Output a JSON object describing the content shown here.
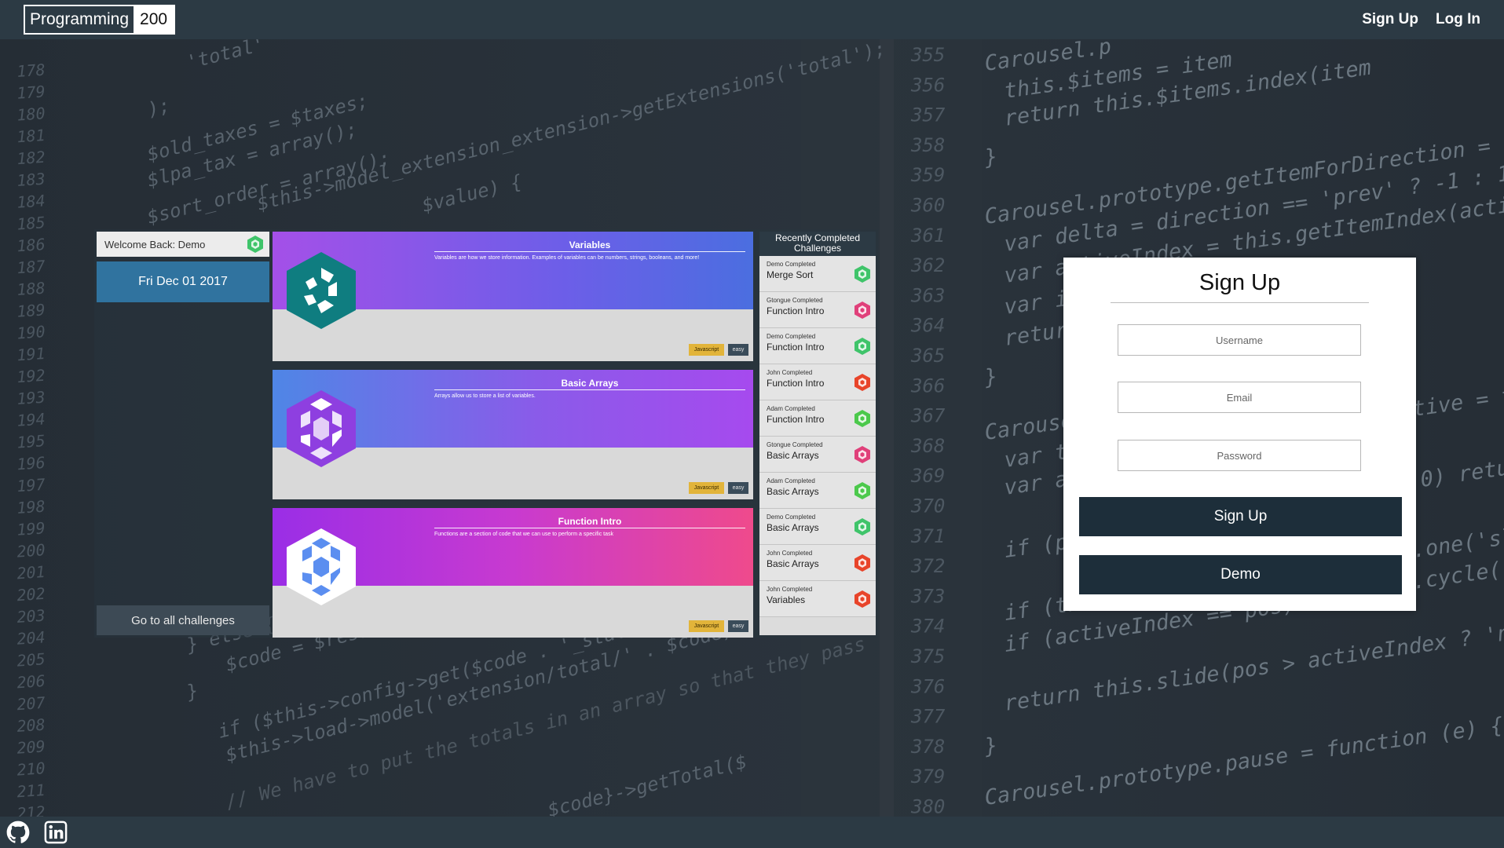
{
  "navbar": {
    "brand_text": "Programming",
    "brand_number": "200",
    "signup_link": "Sign Up",
    "login_link": "Log In"
  },
  "background_code": {
    "left_line_numbers": [
      "178",
      "179",
      "180",
      "181",
      "182",
      "183",
      "184",
      "185",
      "186",
      "187",
      "188",
      "189",
      "190",
      "191",
      "192",
      "193",
      "194",
      "195",
      "196",
      "197",
      "198",
      "199",
      "200",
      "201",
      "202",
      "203",
      "204",
      "205",
      "206",
      "207",
      "208",
      "209",
      "210",
      "211",
      "212"
    ],
    "right_line_numbers": [
      "355",
      "356",
      "357",
      "358",
      "359",
      "360",
      "361",
      "362",
      "363",
      "364",
      "365",
      "366",
      "367",
      "368",
      "369",
      "370",
      "371",
      "372",
      "373",
      "374",
      "375",
      "376",
      "377",
      "378",
      "379",
      "380"
    ],
    "left_lines": [
      "'total'",
      ");",
      "$old_taxes = $taxes;",
      "$lpa_tax = array();",
      "$sort_order = array();",
      "$this->model_extension_extension->getExtensions('total');",
      "$value) {",
      "} else {",
      "$code = $result[",
      "}",
      "if ($this->config->get($code . '_status')) {",
      "$this->load->model('extension/total/' . $code);",
      "// We have to put the totals in an array so that they pass",
      "$code}->getTotal($"
    ],
    "right_lines": [
      "Carousel.p",
      "this.$items = item",
      "return this.$items.index(item",
      "}",
      "Carousel.prototype.getItemForDirection = function (dire",
      "var delta = direction == 'prev' ? -1 : 1",
      "var activeIndex = this.getItemIndex(active)",
      "var it",
      "return",
      "}",
      "Carousel",
      "var th",
      "var ac",
      "if (po",
      "if (th",
      "if (activeIndex == pos)",
      "return this.slide(pos > activeIndex ? 'next' : 'prev'",
      "}",
      "Carousel.prototype.pause = function (e) {",
      "tive = th",
      "0) return",
      ".one('sli",
      ".cycle()"
    ]
  },
  "dashboard": {
    "welcome_text": "Welcome Back: Demo",
    "date": "Fri Dec 01 2017",
    "all_challenges_button": "Go to all challenges",
    "cards": [
      {
        "title": "Variables",
        "description": "Variables are how we store information. Examples of variables can be numbers, strings, booleans, and more!",
        "language": "Javascript",
        "difficulty": "easy"
      },
      {
        "title": "Basic Arrays",
        "description": "Arrays allow us to store a list of variables.",
        "language": "Javascript",
        "difficulty": "easy"
      },
      {
        "title": "Function Intro",
        "description": "Functions are a section of code that we can use to perform a specific task",
        "language": "Javascript",
        "difficulty": "easy"
      }
    ],
    "recent": {
      "heading_line1": "Recently Completed",
      "heading_line2": "Challenges",
      "items": [
        {
          "who": "Demo Completed",
          "challenge": "Merge Sort",
          "avatar_color": "#3fc46a"
        },
        {
          "who": "Gtongue Completed",
          "challenge": "Function Intro",
          "avatar_color": "#e0407a"
        },
        {
          "who": "Demo Completed",
          "challenge": "Function Intro",
          "avatar_color": "#3fc46a"
        },
        {
          "who": "John Completed",
          "challenge": "Function Intro",
          "avatar_color": "#e8442a"
        },
        {
          "who": "Adam Completed",
          "challenge": "Function Intro",
          "avatar_color": "#4cc94c"
        },
        {
          "who": "Gtongue Completed",
          "challenge": "Basic Arrays",
          "avatar_color": "#e0407a"
        },
        {
          "who": "Adam Completed",
          "challenge": "Basic Arrays",
          "avatar_color": "#4cc94c"
        },
        {
          "who": "Demo Completed",
          "challenge": "Basic Arrays",
          "avatar_color": "#3fc46a"
        },
        {
          "who": "John Completed",
          "challenge": "Basic Arrays",
          "avatar_color": "#e8442a"
        },
        {
          "who": "John Completed",
          "challenge": "Variables",
          "avatar_color": "#e8442a"
        }
      ]
    }
  },
  "signup_form": {
    "title": "Sign Up",
    "username_placeholder": "Username",
    "email_placeholder": "Email",
    "password_placeholder": "Password",
    "signup_button": "Sign Up",
    "demo_button": "Demo"
  },
  "footer": {
    "icons": [
      "github-icon",
      "linkedin-icon"
    ]
  },
  "colors": {
    "navbar_bg": "#2c3a44",
    "date_bg": "#30739f",
    "button_dark": "#1d2e3a",
    "tag_language": "#e2b43a"
  }
}
